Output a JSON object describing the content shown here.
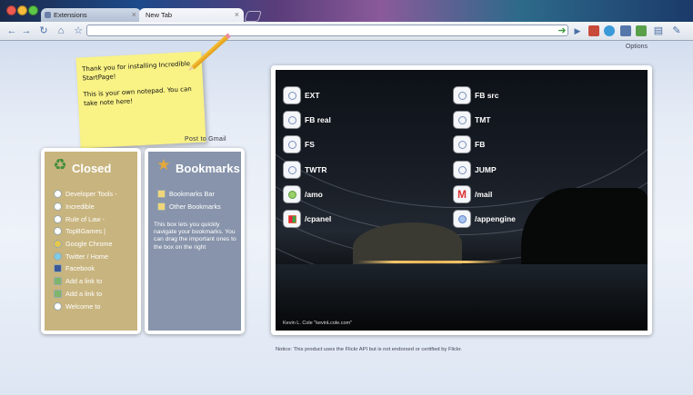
{
  "window": {
    "tabs": [
      {
        "label": "Extensions"
      },
      {
        "label": "New Tab"
      }
    ]
  },
  "toolbar": {
    "address_value": ""
  },
  "page": {
    "options_label": "Options",
    "post_to_gmail": "Post to Gmail",
    "note": {
      "line1": "Thank you for installing Incredible StartPage!",
      "line2": "This is your own notepad. You can take note here!"
    },
    "notice": "Notice: This product uses the Flickr API but is not endorsed or certified by Flickr."
  },
  "closed": {
    "title": "Closed",
    "items": [
      {
        "label": "Developer Tools -"
      },
      {
        "label": "Incredible"
      },
      {
        "label": "Rule of Law -"
      },
      {
        "label": "TopBGames |"
      },
      {
        "label": "Google Chrome"
      },
      {
        "label": "Twitter / Home"
      },
      {
        "label": "Facebook"
      },
      {
        "label": "Add a link to"
      },
      {
        "label": "Add a link to"
      },
      {
        "label": "Welcome to"
      }
    ]
  },
  "bookmarks": {
    "title": "Bookmarks",
    "items": [
      {
        "label": "Bookmarks Bar"
      },
      {
        "label": "Other Bookmarks"
      }
    ],
    "help": "This box lets you quickly navigate your bookmarks. You can drag the important ones to the box on the right"
  },
  "shortcuts": {
    "left": [
      {
        "label": "EXT"
      },
      {
        "label": "FB real"
      },
      {
        "label": "FS"
      },
      {
        "label": "TWTR"
      },
      {
        "label": "/amo"
      },
      {
        "label": "/cpanel"
      }
    ],
    "right": [
      {
        "label": "FB src"
      },
      {
        "label": "TMT"
      },
      {
        "label": "FB"
      },
      {
        "label": "JUMP"
      },
      {
        "label": "/mail"
      },
      {
        "label": "/appengine"
      }
    ]
  },
  "photo_credit": "Kevin L. Cole \"kevinLcole.com\"",
  "colors": {
    "closed_panel": "#c8b47e",
    "bookmarks_panel": "#8794ab"
  }
}
